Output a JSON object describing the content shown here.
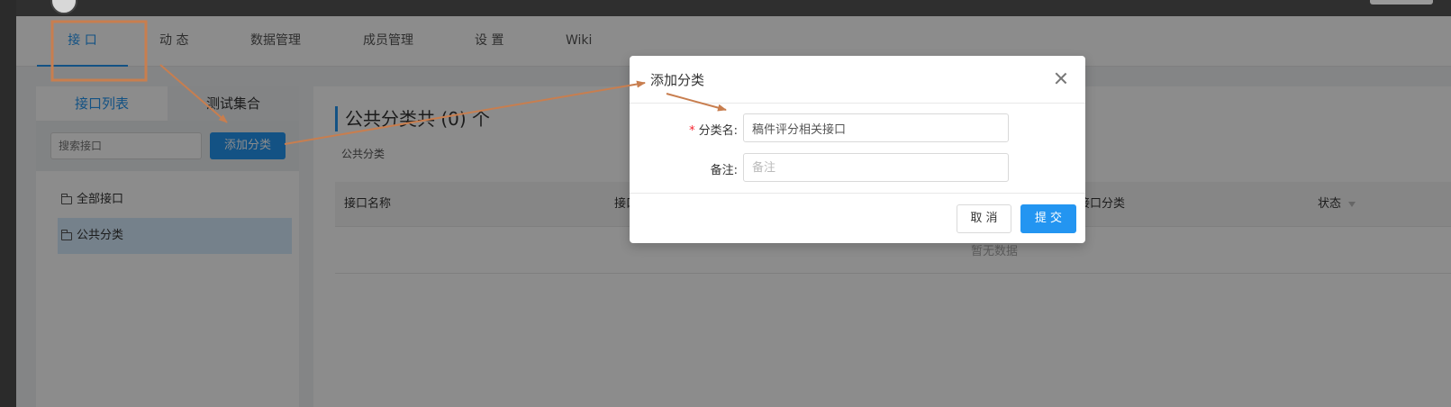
{
  "nav_tabs": [
    {
      "label": "接 口"
    },
    {
      "label": "动 态"
    },
    {
      "label": "数据管理"
    },
    {
      "label": "成员管理"
    },
    {
      "label": "设 置"
    },
    {
      "label": "Wiki"
    }
  ],
  "sidebar": {
    "tabs": [
      {
        "label": "接口列表"
      },
      {
        "label": "测试集合"
      }
    ],
    "search_placeholder": "搜索接口",
    "add_button": "添加分类",
    "items": [
      {
        "label": "全部接口"
      },
      {
        "label": "公共分类"
      }
    ]
  },
  "main": {
    "category_title": "公共分类共 (0) 个",
    "category_desc": "公共分类",
    "columns": [
      "接口名称",
      "接口路径",
      "接口分类",
      "状态"
    ],
    "empty_text": "暂无数据"
  },
  "modal": {
    "title": "添加分类",
    "name_label": "分类名:",
    "name_value": "稿件评分相关接口",
    "note_label": "备注:",
    "note_placeholder": "备注",
    "cancel": "取 消",
    "submit": "提 交"
  },
  "colors": {
    "primary": "#2395f1",
    "annotation": "#c87e4f",
    "required": "#f5222d"
  }
}
